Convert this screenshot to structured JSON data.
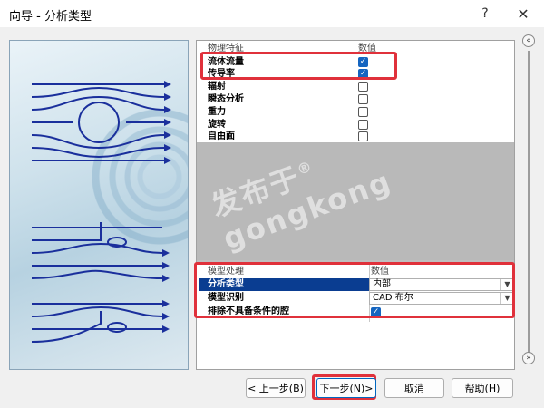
{
  "window": {
    "title": "向导 - 分析类型",
    "help_glyph": "?",
    "close_glyph": "✕"
  },
  "physics_table": {
    "col_name": "物理特征",
    "col_value": "数值",
    "rows": [
      {
        "label": "流体流量",
        "checked": true
      },
      {
        "label": "传导率",
        "checked": true
      },
      {
        "label": "辐射",
        "checked": false
      },
      {
        "label": "瞬态分析",
        "checked": false
      },
      {
        "label": "重力",
        "checked": false
      },
      {
        "label": "旋转",
        "checked": false
      },
      {
        "label": "自由面",
        "checked": false
      }
    ]
  },
  "model_table": {
    "col_name": "模型处理",
    "col_value": "数值",
    "analysis_type_label": "分析类型",
    "analysis_type_value": "内部",
    "model_id_label": "模型识别",
    "model_id_value": "CAD 布尔",
    "exclude_label": "排除不具备条件的腔",
    "exclude_checked": true
  },
  "watermark": {
    "line1": "发布于",
    "line2": "gongkong",
    "reg": "®"
  },
  "buttons": {
    "back": "< 上一步(B)",
    "next": "下一步(N)>",
    "cancel": "取消",
    "help": "帮助(H)"
  },
  "scroll": {
    "up_glyph": "«",
    "down_glyph": "»"
  },
  "colors": {
    "highlight": "#e0313b",
    "selection": "#0a3d91",
    "checkbox": "#1565c0"
  }
}
